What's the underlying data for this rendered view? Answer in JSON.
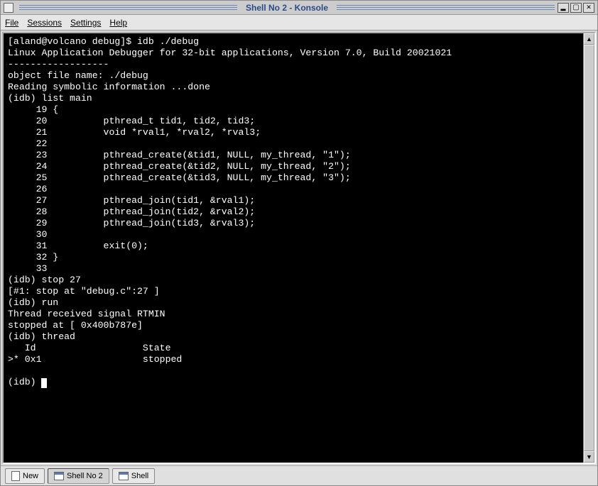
{
  "window": {
    "title": "Shell No 2 - Konsole"
  },
  "menubar": {
    "items": [
      "File",
      "Sessions",
      "Settings",
      "Help"
    ]
  },
  "terminal": {
    "prompt_line": "[aland@volcano debug]$ idb ./debug",
    "banner": "Linux Application Debugger for 32-bit applications, Version 7.0, Build 20021021",
    "divider": "------------------",
    "obj": "object file name: ./debug",
    "reading": "Reading symbolic information ...done",
    "cmd_list": "(idb) list main",
    "l19": "     19 {",
    "l20": "     20          pthread_t tid1, tid2, tid3;",
    "l21": "     21          void *rval1, *rval2, *rval3;",
    "l22": "     22 ",
    "l23": "     23          pthread_create(&tid1, NULL, my_thread, \"1\");",
    "l24": "     24          pthread_create(&tid2, NULL, my_thread, \"2\");",
    "l25": "     25          pthread_create(&tid3, NULL, my_thread, \"3\");",
    "l26": "     26 ",
    "l27": "     27          pthread_join(tid1, &rval1);",
    "l28": "     28          pthread_join(tid2, &rval2);",
    "l29": "     29          pthread_join(tid3, &rval3);",
    "l30": "     30 ",
    "l31": "     31          exit(0);",
    "l32": "     32 }",
    "l33": "     33 ",
    "cmd_stop": "(idb) stop 27",
    "stop_out": "[#1: stop at \"debug.c\":27 ]",
    "cmd_run": "(idb) run",
    "signal": "Thread received signal RTMIN",
    "stopped_at": "stopped at [ 0x400b787e]",
    "cmd_thread": "(idb) thread",
    "th_header": "   Id                   State",
    "th_row": ">* 0x1                  stopped",
    "blank": "",
    "last_prompt": "(idb) "
  },
  "tabs": {
    "new_label": "New",
    "tab1_label": "Shell No 2",
    "tab2_label": "Shell"
  }
}
